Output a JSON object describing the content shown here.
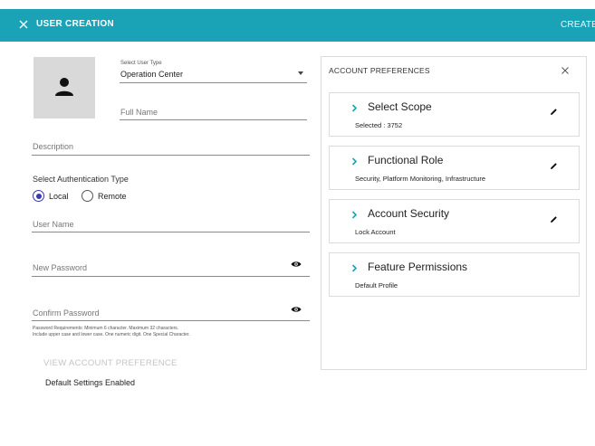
{
  "header": {
    "close_icon": "close-icon",
    "title": "USER CREATION",
    "create_label": "CREATE",
    "background": "#1aa3b6",
    "text_color": "#ffffff"
  },
  "form": {
    "avatar_icon": "person-icon",
    "user_type": {
      "label": "Select User Type",
      "value": "Operation Center"
    },
    "full_name": {
      "placeholder": "Full Name",
      "value": ""
    },
    "description": {
      "placeholder": "Description",
      "value": ""
    },
    "auth": {
      "label": "Select Authentication Type",
      "options": [
        {
          "label": "Local",
          "checked": true
        },
        {
          "label": "Remote",
          "checked": false
        }
      ],
      "accent_color": "#3a3aa8"
    },
    "user_name": {
      "placeholder": "User Name",
      "value": ""
    },
    "new_password": {
      "placeholder": "New Password",
      "value": "",
      "icon": "eye-icon"
    },
    "confirm_password": {
      "placeholder": "Confirm Password",
      "value": "",
      "icon": "eye-icon"
    },
    "password_requirements_line1": "Password Requirements: Minimum 6 character. Maximum 32 characters.",
    "password_requirements_line2": "Include upper case and lower case. One numeric digit. One Special Character.",
    "view_account_preference": "VIEW ACCOUNT PREFERENCE",
    "default_settings": "Default Settings Enabled"
  },
  "preferences": {
    "title": "ACCOUNT PREFERENCES",
    "close_icon": "close-icon",
    "chevron_color": "#1aa3b6",
    "cards": [
      {
        "title": "Select Scope",
        "subtitle": "Selected : 3752",
        "editable": true
      },
      {
        "title": "Functional Role",
        "subtitle": "Security, Platform Monitoring, Infrastructure",
        "editable": true
      },
      {
        "title": "Account Security",
        "subtitle": "Lock Account",
        "editable": true
      },
      {
        "title": "Feature Permissions",
        "subtitle": "Default Profile",
        "editable": false
      }
    ]
  }
}
